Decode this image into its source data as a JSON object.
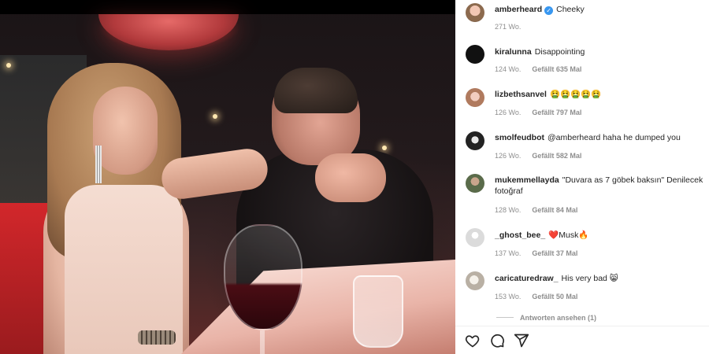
{
  "post": {
    "author": "amberheard",
    "caption": "Cheeky",
    "age": "271 Wo.",
    "verified": true
  },
  "comments": [
    {
      "username": "kiralunna",
      "text": "Disappointing",
      "age": "124 Wo.",
      "likes": "Gefällt 635 Mal",
      "avatar_color": "#111111"
    },
    {
      "username": "lizbethsanvel",
      "text": "🤮🤮🤮🤮🤮",
      "age": "126 Wo.",
      "likes": "Gefällt 797 Mal",
      "avatar_color": "#d9a48f"
    },
    {
      "username": "smolfeudbot",
      "text": "@amberheard haha he dumped you",
      "age": "126 Wo.",
      "likes": "Gefällt 582 Mal",
      "avatar_color": "#2b2b2b"
    },
    {
      "username": "mukemmellayda",
      "text": "\"Duvara as 7 göbek baksın\" Denilecek fotoğraf",
      "age": "128 Wo.",
      "likes": "Gefällt 84 Mal",
      "avatar_color": "#5a6b4a"
    },
    {
      "username": "_ghost_bee_",
      "text": "❤️Musk🔥",
      "age": "137 Wo.",
      "likes": "Gefällt 37 Mal",
      "avatar_color": "#dbdbdb"
    },
    {
      "username": "caricaturedraw_",
      "text": "His very bad 😸",
      "age": "153 Wo.",
      "likes": "Gefällt 50 Mal",
      "avatar_color": "#c9c2b8"
    }
  ],
  "replies_label": "Antworten ansehen (1)",
  "icons": [
    "heart-icon",
    "comment-icon",
    "share-icon"
  ]
}
